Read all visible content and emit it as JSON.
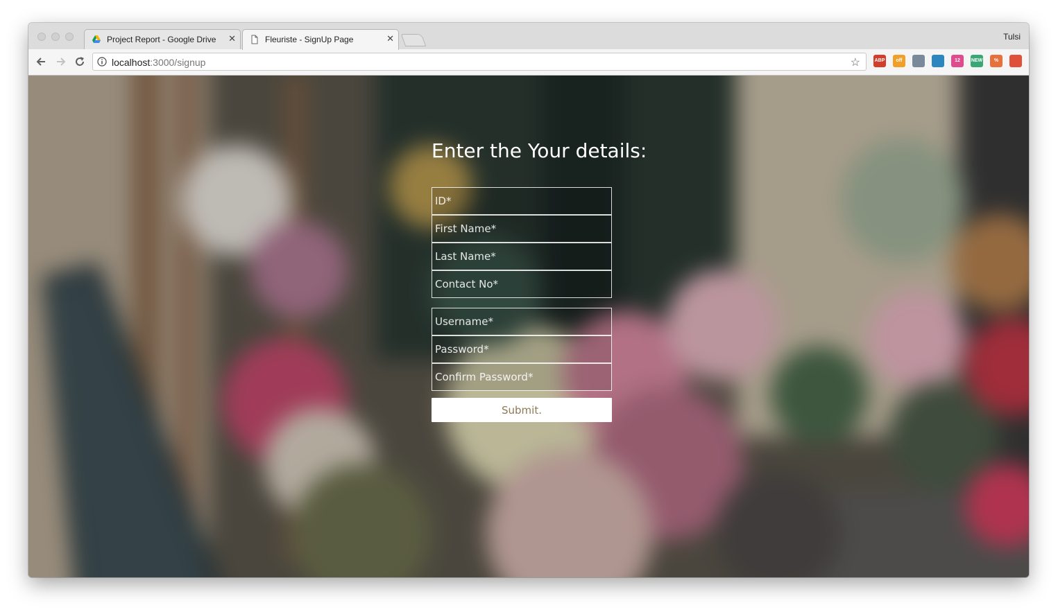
{
  "browser": {
    "tabs": [
      {
        "title": "Project Report - Google Drive",
        "icon": "google-drive-icon",
        "active": false
      },
      {
        "title": "Fleuriste - SignUp Page",
        "icon": "page-icon",
        "active": true
      }
    ],
    "profile_name": "Tulsi",
    "url_host": "localhost",
    "url_path": ":3000/signup",
    "extensions": [
      {
        "name": "adblock-plus-icon",
        "label": "ABP",
        "color": "#d33d2c"
      },
      {
        "name": "offers-extension-icon",
        "label": "off",
        "color": "#f0a028"
      },
      {
        "name": "puzzle-extension-icon",
        "label": "",
        "color": "#7a8a9a"
      },
      {
        "name": "translate-extension-icon",
        "label": "",
        "color": "#2e86c1"
      },
      {
        "name": "calendar-extension-icon",
        "label": "12",
        "color": "#e04b8e"
      },
      {
        "name": "new-badge-extension-icon",
        "label": "NEW",
        "color": "#3aa874"
      },
      {
        "name": "percent-extension-icon",
        "label": "%",
        "color": "#e8703a"
      },
      {
        "name": "upload-extension-icon",
        "label": "",
        "color": "#e0513a"
      }
    ]
  },
  "page": {
    "heading": "Enter the Your details:",
    "fields_group1": [
      {
        "placeholder": "ID*",
        "name": "id-field"
      },
      {
        "placeholder": "First Name*",
        "name": "first-name-field"
      },
      {
        "placeholder": "Last Name*",
        "name": "last-name-field"
      },
      {
        "placeholder": "Contact No*",
        "name": "contact-no-field"
      }
    ],
    "fields_group2": [
      {
        "placeholder": "Username*",
        "name": "username-field"
      },
      {
        "placeholder": "Password*",
        "name": "password-field"
      },
      {
        "placeholder": "Confirm Password*",
        "name": "confirm-password-field"
      }
    ],
    "submit_label": "Submit."
  }
}
